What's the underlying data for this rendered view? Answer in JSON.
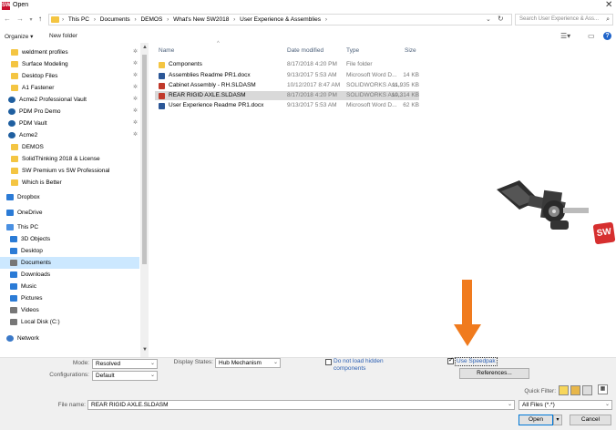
{
  "window": {
    "title": "Open",
    "app_icon": "SW"
  },
  "address": {
    "crumbs": [
      "This PC",
      "Documents",
      "DEMOS",
      "What's New SW2018",
      "User Experience & Assemblies"
    ],
    "search_placeholder": "Search User Experience & Ass..."
  },
  "toolbar": {
    "organize": "Organize ▾",
    "new_folder": "New folder"
  },
  "nav": {
    "items": [
      {
        "label": "weldment profiles",
        "icon": "folder"
      },
      {
        "label": "Surface Modeling",
        "icon": "folder"
      },
      {
        "label": "Desktop Files",
        "icon": "folder"
      },
      {
        "label": "A1 Fastener",
        "icon": "folder"
      },
      {
        "label": "Acme2 Professional Vault",
        "icon": "vault"
      },
      {
        "label": "PDM Pro Demo",
        "icon": "vault"
      },
      {
        "label": "PDM Vault",
        "icon": "vault"
      },
      {
        "label": "Acme2",
        "icon": "vault"
      },
      {
        "label": "DEMOS",
        "icon": "folder"
      },
      {
        "label": "SolidThinking 2018 & License",
        "icon": "folder"
      },
      {
        "label": "SW Premium vs SW Professional",
        "icon": "folder"
      },
      {
        "label": "Which is Better",
        "icon": "folder"
      },
      {
        "label": "Dropbox",
        "icon": "blue"
      },
      {
        "label": "OneDrive",
        "icon": "blue"
      },
      {
        "label": "This PC",
        "icon": "pc"
      },
      {
        "label": "3D Objects",
        "icon": "blue"
      },
      {
        "label": "Desktop",
        "icon": "blue"
      },
      {
        "label": "Documents",
        "icon": "drive"
      },
      {
        "label": "Downloads",
        "icon": "blue"
      },
      {
        "label": "Music",
        "icon": "blue"
      },
      {
        "label": "Pictures",
        "icon": "blue"
      },
      {
        "label": "Videos",
        "icon": "drive"
      },
      {
        "label": "Local Disk (C:)",
        "icon": "drive"
      },
      {
        "label": "Network",
        "icon": "net"
      }
    ]
  },
  "columns": {
    "name": "Name",
    "date": "Date modified",
    "type": "Type",
    "size": "Size"
  },
  "files": [
    {
      "name": "Components",
      "date": "8/17/2018 4:20 PM",
      "type": "File folder",
      "size": "",
      "icon": "folder"
    },
    {
      "name": "Assemblies Readme PR1.docx",
      "date": "9/13/2017 5:53 AM",
      "type": "Microsoft Word D...",
      "size": "14 KB",
      "icon": "doc"
    },
    {
      "name": "Cabinet Assembly - RH.SLDASM",
      "date": "10/12/2017 8:47 AM",
      "type": "SOLIDWORKS Ass...",
      "size": "11,935 KB",
      "icon": "asm"
    },
    {
      "name": "REAR RIGID AXLE.SLDASM",
      "date": "8/17/2018 4:20 PM",
      "type": "SOLIDWORKS Ass...",
      "size": "10,314 KB",
      "icon": "asm"
    },
    {
      "name": "User Experience Readme PR1.docx",
      "date": "9/13/2017 5:53 AM",
      "type": "Microsoft Word D...",
      "size": "62 KB",
      "icon": "doc"
    }
  ],
  "options": {
    "mode_label": "Mode:",
    "mode_value": "Resolved",
    "config_label": "Configurations:",
    "config_value": "Default",
    "display_label": "Display States:",
    "display_value": "Hub Mechanism",
    "hidden_components": "Do not load hidden components",
    "speedpak": "Use Speedpak",
    "references": "References...",
    "quick_filter": "Quick Filter:"
  },
  "footer": {
    "filename_label": "File name:",
    "filename_value": "REAR RIGID AXLE.SLDASM",
    "filter_value": "All Files (*.*)",
    "open": "Open",
    "cancel": "Cancel"
  }
}
